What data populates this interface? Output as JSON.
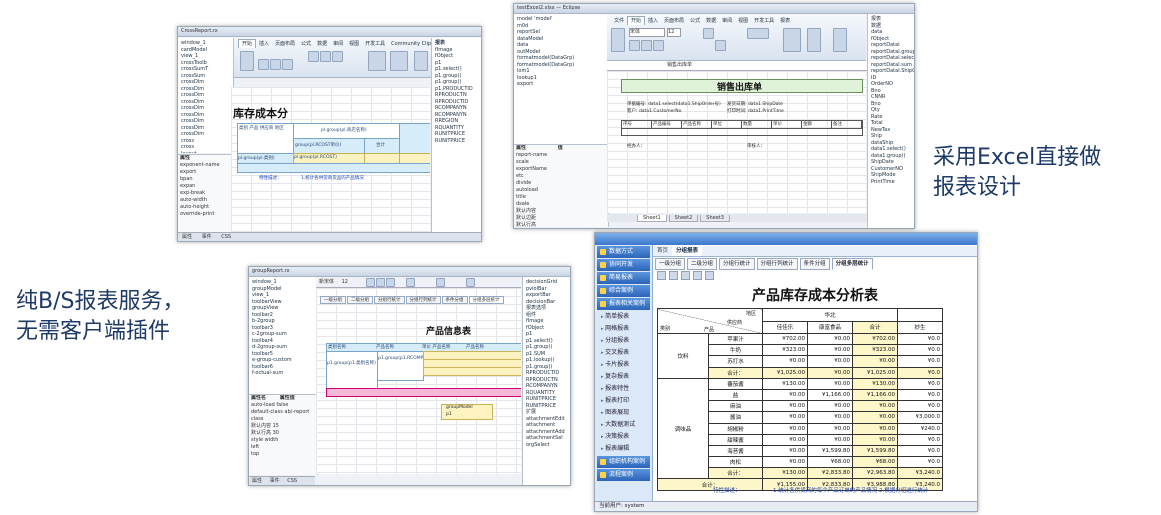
{
  "captions": {
    "excel_design": [
      "采用Excel直接做",
      "报表设计"
    ],
    "bs_service": [
      "纯B/S报表服务，",
      "无需客户端插件"
    ]
  },
  "shot1": {
    "title": "CrossReport.rx",
    "tabs": [
      "开始",
      "插入",
      "页面布局",
      "公式",
      "数据",
      "审阅",
      "视图",
      "开发工具",
      "Community Clips",
      "报表"
    ],
    "tree": [
      "window_1",
      "cardModel",
      "view_1",
      "crossToolb",
      "crossSumT",
      "crossSum",
      "crossDim",
      "crossDim",
      "crossDim",
      "crossDim",
      "crossDim",
      "crossDim",
      "crossDim",
      "crossDim",
      "crossDim",
      "cross",
      "cross",
      "layout"
    ],
    "props_header": "属性",
    "props": [
      "exponent-name",
      "export",
      "bpan",
      "expan",
      "exp-break",
      "auto-width",
      "auto-height",
      "override-print"
    ],
    "sheet_title": "库存成本分",
    "fields": [
      "类别 产品 供应商 地区",
      "pl.group(pl.商店名称)",
      "group(pl.RCOST单价)",
      "合计",
      "pl.group(pl.类别)",
      "pl.group(pl.RCOST)",
      "特性描述：",
      "1.统计各供货商货品的产品情况"
    ],
    "right_pane_header": "报表",
    "right_pane": [
      "fImage",
      "fObject",
      "p1",
      "p1.select()",
      "p1.group()",
      "p1.group()",
      "p1.PRODUCTID",
      "RPRODUCTN",
      "RPRODUCTID",
      "RCOMPANYN",
      "RCOMPANYN",
      "RREGION",
      "RQUANTITY",
      "RUNITPRICE",
      "RUNITPRICE"
    ],
    "status": [
      "属性",
      "事件",
      "CSS"
    ]
  },
  "shot2": {
    "title": "testExcel2.xlsx — Eclipse",
    "tabs": [
      "文件",
      "开始",
      "插入",
      "页面布局",
      "公式",
      "数据",
      "审阅",
      "视图",
      "开发工具",
      "报表"
    ],
    "font": "宋体",
    "font_size": "12",
    "tree": [
      "model 'model'",
      "m0d",
      "reportSel",
      "dataModel",
      "data",
      "outModel",
      "formatmodel(DataGrp)",
      "formatmodel(DataGrp)",
      "lom1",
      "lookup1",
      "export"
    ],
    "formula": "销售出库单",
    "sheet_title": "销售出库单",
    "rows": [
      "单据编号:  data1.select(data1.ShipOrder号)",
      "客户:  data1.CustomerNo",
      "发货日期: data1.ShipDate",
      "打印时间: data1.PrintTime",
      "经办人：",
      "审核人："
    ],
    "columns": [
      "序号",
      "产品编号",
      "产品名称",
      "单位",
      "数量",
      "单价",
      "金额",
      "备注"
    ],
    "props_header": [
      "属性",
      "值"
    ],
    "props": [
      "report-name",
      "scale",
      "exportName",
      "etc",
      "divide",
      "autoload",
      "title",
      "dsale",
      "默认内容",
      "默认边距",
      "默认行高",
      "位置"
    ],
    "sheets": [
      "Sheet1",
      "Sheet2",
      "Sheet3"
    ],
    "right_pane": [
      "报表",
      "数据",
      "data",
      "fObject",
      "reportDatal",
      "reportDatal.group",
      "reportDatal.select",
      "reportDatal.sum",
      "reportDatal.ShipOrder",
      "ID",
      "OrderNO",
      "Bno",
      "CNNR",
      "Bno",
      "Qty",
      "Rate",
      "Total",
      "NewTax",
      "Ship",
      "dataShip",
      "data1.select()",
      "data1.group()",
      "ShipDate",
      "CustomerNO",
      "ShipMode",
      "PrintTime"
    ]
  },
  "shot3": {
    "title": "groupReport.rx",
    "font": "新宋体",
    "font_size": "12",
    "tree": [
      "window_1",
      "groupModel",
      "view_1",
      "toolbarView",
      "groupView",
      "toolbar2",
      "b-2group",
      "toolbar3",
      "c-2group-sum",
      "toolbar4",
      "d-2group-sum",
      "toolbar5",
      "e-group-custom",
      "toolbar6",
      "f-octual-sum"
    ],
    "tabs": [
      "一级分组",
      "二级分组",
      "分组行统计",
      "分组行列统计",
      "条件分组",
      "分组多层统计"
    ],
    "sheet_title": "产品信息表",
    "fields": [
      "类别名称",
      "产品名称",
      "单价 产品名称",
      "产品名称",
      "p1.group(p1.类别名称)",
      "p1.group(p1.RCOMPANYN)",
      "groupModel",
      "p1"
    ],
    "props_header": [
      "属性名",
      "属性值"
    ],
    "props": [
      "auto-load  false",
      "default-class  ab/-report",
      "class",
      "默认内容  15",
      "默认行高  30",
      "style  width",
      "left",
      "top"
    ],
    "status": [
      "属性",
      "事件",
      "CSS"
    ],
    "right_pane": [
      "decisionGrid",
      "pviolBar",
      "exportBar",
      "decisionBar",
      "报表选项",
      "组件",
      "fImage",
      "fObject",
      "p1",
      "p1.select()",
      "p1.group()",
      "p1.SUM",
      "p1.lookup()",
      "p1.group()",
      "RPRODUCTID",
      "RPRODUCTN",
      "RCOMPANYN",
      "RQUANTITY",
      "RUNITPRICE",
      "RUNITPRICE",
      "扩展",
      "attachmentEdit",
      "attachment",
      "attachmentAdd",
      "attachmentSel",
      "orgSelect"
    ]
  },
  "shot4": {
    "header_tabs": [
      "首页",
      "分组报表"
    ],
    "menu": [
      {
        "type": "group",
        "label": "数据方式"
      },
      {
        "type": "group",
        "label": "协同开发"
      },
      {
        "type": "group",
        "label": "简易报表"
      },
      {
        "type": "group",
        "label": "综合案例"
      },
      {
        "type": "group",
        "label": "报表相关案例"
      },
      {
        "type": "sub",
        "label": "简单报表"
      },
      {
        "type": "sub",
        "label": "网格报表"
      },
      {
        "type": "sub",
        "label": "分组报表"
      },
      {
        "type": "sub",
        "label": "交叉报表"
      },
      {
        "type": "sub",
        "label": "卡片报表"
      },
      {
        "type": "sub",
        "label": "复杂报表"
      },
      {
        "type": "sub",
        "label": "报表特性"
      },
      {
        "type": "sub",
        "label": "报表打印"
      },
      {
        "type": "sub",
        "label": "图表展现"
      },
      {
        "type": "sub",
        "label": "大数据测试"
      },
      {
        "type": "sub",
        "label": "决策报表"
      },
      {
        "type": "sub",
        "label": "报表编辑"
      },
      {
        "type": "group",
        "label": "组织机构案例"
      },
      {
        "type": "group",
        "label": "流程案例"
      }
    ],
    "sub_tabs": [
      "一级分组",
      "二级分组",
      "分组行统计",
      "分组行列统计",
      "条件分组",
      "分组多层统计"
    ],
    "report_title": "产品库存成本分析表",
    "table": {
      "corner": [
        "地区",
        "供应商",
        "产品",
        "类别"
      ],
      "region": "华北",
      "suppliers": [
        "佳佳乐",
        "康富食品",
        "合计",
        "妙生"
      ],
      "rows": [
        {
          "cat": "饮料",
          "prod": "苹果汁",
          "v": [
            "¥702.00",
            "¥0.00",
            "¥702.00",
            "¥0.0"
          ]
        },
        {
          "cat": "",
          "prod": "牛奶",
          "v": [
            "¥323.00",
            "¥0.00",
            "¥323.00",
            "¥0.0"
          ]
        },
        {
          "cat": "",
          "prod": "苏打水",
          "v": [
            "¥0.00",
            "¥0.00",
            "¥0.00",
            "¥0.0"
          ]
        },
        {
          "cat": "",
          "prod": "合计：",
          "v": [
            "¥1,025.00",
            "¥0.00",
            "¥1,025.00",
            "¥0.0"
          ],
          "total": true
        },
        {
          "cat": "调味品",
          "prod": "蕃茄酱",
          "v": [
            "¥130.00",
            "¥0.00",
            "¥130.00",
            "¥0.0"
          ]
        },
        {
          "cat": "",
          "prod": "盐",
          "v": [
            "¥0.00",
            "¥1,166.00",
            "¥1,166.00",
            "¥0.0"
          ]
        },
        {
          "cat": "",
          "prod": "麻油",
          "v": [
            "¥0.00",
            "¥0.00",
            "¥0.00",
            "¥0.0"
          ]
        },
        {
          "cat": "",
          "prod": "酱油",
          "v": [
            "¥0.00",
            "¥0.00",
            "¥0.00",
            "¥3,000.0"
          ]
        },
        {
          "cat": "",
          "prod": "胡椒粉",
          "v": [
            "¥0.00",
            "¥0.00",
            "¥0.00",
            "¥240.0"
          ]
        },
        {
          "cat": "",
          "prod": "甜辣酱",
          "v": [
            "¥0.00",
            "¥0.00",
            "¥0.00",
            "¥0.0"
          ]
        },
        {
          "cat": "",
          "prod": "海苔酱",
          "v": [
            "¥0.00",
            "¥1,599.80",
            "¥1,599.80",
            "¥0.0"
          ]
        },
        {
          "cat": "",
          "prod": "肉松",
          "v": [
            "¥0.00",
            "¥68.00",
            "¥68.00",
            "¥0.0"
          ]
        },
        {
          "cat": "",
          "prod": "合计：",
          "v": [
            "¥130.00",
            "¥2,833.80",
            "¥2,963.80",
            "¥3,240.0"
          ],
          "total": true
        },
        {
          "cat": "合计：",
          "prod": "",
          "v": [
            "¥1,155.00",
            "¥2,833.80",
            "¥3,988.80",
            "¥3,240.0"
          ],
          "grand": true
        }
      ]
    },
    "note_label": "特性描述：",
    "note_text": "1.统计各供货商的每个产品订单的产品情况 2.根据分组进行统计",
    "footer": "当前用户: system"
  }
}
